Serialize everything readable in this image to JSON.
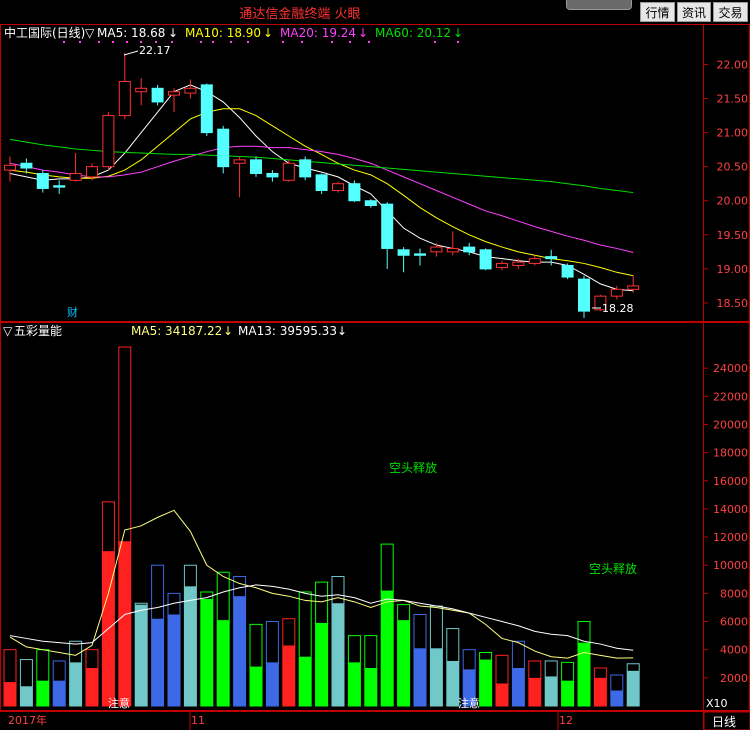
{
  "app": {
    "title": "通达信金融终端  火眼"
  },
  "toolbar": {
    "market": "行情",
    "info": "资讯",
    "trade": "交易"
  },
  "price_panel": {
    "name": "中工国际(日线)",
    "indicators": [
      {
        "label": "MA5: 18.68",
        "color": "#ffffff"
      },
      {
        "label": "MA10: 18.90",
        "color": "#ffff00"
      },
      {
        "label": "MA20: 19.24",
        "color": "#ff40ff"
      },
      {
        "label": "MA60: 20.12",
        "color": "#00e000"
      }
    ],
    "high_label": "22.17",
    "low_label": "18.28",
    "cai_badge": "财",
    "y_ticks": [
      "22.00",
      "21.50",
      "21.00",
      "20.50",
      "20.00",
      "19.50",
      "19.00",
      "18.50"
    ]
  },
  "volume_panel": {
    "name": "五彩量能",
    "indicators": [
      {
        "label": "MA5: 34187.22",
        "color": "#ffff80"
      },
      {
        "label": "MA13: 39595.33",
        "color": "#ffffff"
      }
    ],
    "annotations": [
      "空头释放",
      "空头释放"
    ],
    "notes": [
      "注意",
      "注意"
    ],
    "y_ticks": [
      "24000",
      "22000",
      "20000",
      "18000",
      "16000",
      "14000",
      "12000",
      "10000",
      "8000",
      "6000",
      "4000",
      "2000"
    ],
    "unit": "X10"
  },
  "x_axis": {
    "labels": [
      "2017年",
      "11",
      "12"
    ],
    "period": "日线"
  },
  "colors": {
    "up": "#ff3030",
    "down": "#54ffff",
    "grid": "#c00000",
    "volume_red": "#ff2020",
    "volume_cyan": "#70c8c8",
    "volume_blue": "#3d68e6",
    "volume_green": "#00ff00"
  },
  "chart_data": {
    "type": "candlestick",
    "candles": [
      {
        "o": 20.45,
        "c": 20.52,
        "h": 20.65,
        "l": 20.28
      },
      {
        "o": 20.55,
        "c": 20.48,
        "h": 20.62,
        "l": 20.4
      },
      {
        "o": 20.4,
        "c": 20.18,
        "h": 20.45,
        "l": 20.12
      },
      {
        "o": 20.22,
        "c": 20.2,
        "h": 20.3,
        "l": 20.1
      },
      {
        "o": 20.3,
        "c": 20.4,
        "h": 20.7,
        "l": 20.28
      },
      {
        "o": 20.35,
        "c": 20.5,
        "h": 20.55,
        "l": 20.3
      },
      {
        "o": 20.5,
        "c": 21.25,
        "h": 21.3,
        "l": 20.45
      },
      {
        "o": 21.25,
        "c": 21.75,
        "h": 22.17,
        "l": 21.2
      },
      {
        "o": 21.6,
        "c": 21.65,
        "h": 21.8,
        "l": 21.4
      },
      {
        "o": 21.65,
        "c": 21.45,
        "h": 21.7,
        "l": 21.4
      },
      {
        "o": 21.55,
        "c": 21.6,
        "h": 21.65,
        "l": 21.3
      },
      {
        "o": 21.58,
        "c": 21.65,
        "h": 21.78,
        "l": 21.5
      },
      {
        "o": 21.7,
        "c": 21.0,
        "h": 21.72,
        "l": 20.95
      },
      {
        "o": 21.05,
        "c": 20.5,
        "h": 21.1,
        "l": 20.4
      },
      {
        "o": 20.55,
        "c": 20.6,
        "h": 20.65,
        "l": 20.05
      },
      {
        "o": 20.6,
        "c": 20.4,
        "h": 20.65,
        "l": 20.35
      },
      {
        "o": 20.4,
        "c": 20.35,
        "h": 20.45,
        "l": 20.28
      },
      {
        "o": 20.3,
        "c": 20.55,
        "h": 20.6,
        "l": 20.28
      },
      {
        "o": 20.6,
        "c": 20.35,
        "h": 20.65,
        "l": 20.3
      },
      {
        "o": 20.38,
        "c": 20.15,
        "h": 20.4,
        "l": 20.1
      },
      {
        "o": 20.15,
        "c": 20.25,
        "h": 20.28,
        "l": 20.12
      },
      {
        "o": 20.25,
        "c": 20.0,
        "h": 20.3,
        "l": 19.98
      },
      {
        "o": 20.0,
        "c": 19.93,
        "h": 20.02,
        "l": 19.9
      },
      {
        "o": 19.95,
        "c": 19.3,
        "h": 19.98,
        "l": 19.0
      },
      {
        "o": 19.28,
        "c": 19.2,
        "h": 19.32,
        "l": 18.95
      },
      {
        "o": 19.22,
        "c": 19.2,
        "h": 19.3,
        "l": 19.05
      },
      {
        "o": 19.25,
        "c": 19.32,
        "h": 19.38,
        "l": 19.18
      },
      {
        "o": 19.25,
        "c": 19.3,
        "h": 19.55,
        "l": 19.2
      },
      {
        "o": 19.32,
        "c": 19.25,
        "h": 19.38,
        "l": 19.2
      },
      {
        "o": 19.28,
        "c": 19.0,
        "h": 19.3,
        "l": 18.98
      },
      {
        "o": 19.02,
        "c": 19.08,
        "h": 19.12,
        "l": 18.98
      },
      {
        "o": 19.05,
        "c": 19.1,
        "h": 19.15,
        "l": 19.0
      },
      {
        "o": 19.08,
        "c": 19.15,
        "h": 19.2,
        "l": 19.05
      },
      {
        "o": 19.18,
        "c": 19.15,
        "h": 19.28,
        "l": 19.05
      },
      {
        "o": 19.05,
        "c": 18.88,
        "h": 19.08,
        "l": 18.85
      },
      {
        "o": 18.85,
        "c": 18.38,
        "h": 18.9,
        "l": 18.28
      },
      {
        "o": 18.4,
        "c": 18.6,
        "h": 18.62,
        "l": 18.38
      },
      {
        "o": 18.6,
        "c": 18.7,
        "h": 18.75,
        "l": 18.55
      },
      {
        "o": 18.7,
        "c": 18.75,
        "h": 18.9,
        "l": 18.65
      }
    ],
    "ma_lines": [
      {
        "name": "MA5",
        "color": "#ffffff",
        "values": [
          20.4,
          20.35,
          20.3,
          20.32,
          20.32,
          20.35,
          20.45,
          20.7,
          21.0,
          21.3,
          21.6,
          21.7,
          21.6,
          21.45,
          21.22,
          20.95,
          20.72,
          20.55,
          20.48,
          20.42,
          20.35,
          20.22,
          20.1,
          19.85,
          19.6,
          19.45,
          19.35,
          19.3,
          19.25,
          19.18,
          19.15,
          19.12,
          19.1,
          19.1,
          19.05,
          18.92,
          18.78,
          18.7,
          18.68
        ]
      },
      {
        "name": "MA10",
        "color": "#ffff00",
        "values": [
          20.45,
          20.42,
          20.38,
          20.35,
          20.33,
          20.33,
          20.36,
          20.45,
          20.6,
          20.8,
          21.0,
          21.2,
          21.3,
          21.35,
          21.35,
          21.25,
          21.1,
          20.95,
          20.8,
          20.68,
          20.55,
          20.45,
          20.38,
          20.25,
          20.08,
          19.9,
          19.75,
          19.62,
          19.5,
          19.4,
          19.32,
          19.25,
          19.2,
          19.15,
          19.12,
          19.08,
          19.02,
          18.95,
          18.9
        ]
      },
      {
        "name": "MA20",
        "color": "#ff40ff",
        "values": [
          20.55,
          20.5,
          20.45,
          20.42,
          20.38,
          20.35,
          20.35,
          20.38,
          20.42,
          20.5,
          20.58,
          20.65,
          20.72,
          20.78,
          20.8,
          20.8,
          20.78,
          20.78,
          20.75,
          20.72,
          20.68,
          20.62,
          20.55,
          20.45,
          20.35,
          20.25,
          20.15,
          20.05,
          19.95,
          19.85,
          19.78,
          19.7,
          19.62,
          19.55,
          19.48,
          19.42,
          19.35,
          19.3,
          19.24
        ]
      },
      {
        "name": "MA60",
        "color": "#00e000",
        "values": [
          20.9,
          20.86,
          20.82,
          20.79,
          20.76,
          20.74,
          20.72,
          20.71,
          20.7,
          20.69,
          20.68,
          20.68,
          20.67,
          20.66,
          20.65,
          20.64,
          20.62,
          20.6,
          20.58,
          20.56,
          20.54,
          20.52,
          20.5,
          20.48,
          20.46,
          20.44,
          20.42,
          20.4,
          20.38,
          20.36,
          20.34,
          20.32,
          20.3,
          20.28,
          20.25,
          20.22,
          20.18,
          20.15,
          20.12
        ]
      }
    ],
    "volume": {
      "values": [
        [
          4000,
          1700
        ],
        [
          3300,
          1400
        ],
        [
          4000,
          1800
        ],
        [
          3200,
          1800
        ],
        [
          4600,
          3100
        ],
        [
          4000,
          2700
        ],
        [
          14500,
          11000
        ],
        [
          25500,
          11700
        ],
        [
          7300,
          7200
        ],
        [
          10000,
          6200
        ],
        [
          8000,
          6500
        ],
        [
          10000,
          8500
        ],
        [
          8100,
          7600
        ],
        [
          9500,
          6100
        ],
        [
          9200,
          7800
        ],
        [
          5800,
          2800
        ],
        [
          6000,
          3100
        ],
        [
          6200,
          4300
        ],
        [
          8100,
          3500
        ],
        [
          8800,
          5900
        ],
        [
          9200,
          7300
        ],
        [
          5000,
          3100
        ],
        [
          5000,
          2700
        ],
        [
          11500,
          8200
        ],
        [
          7200,
          6100
        ],
        [
          6500,
          4100
        ],
        [
          7100,
          4100
        ],
        [
          5500,
          3200
        ],
        [
          4000,
          2600
        ],
        [
          3800,
          3300
        ],
        [
          3600,
          1600
        ],
        [
          4600,
          2700
        ],
        [
          3200,
          2000
        ],
        [
          3200,
          2100
        ],
        [
          3100,
          1800
        ],
        [
          6000,
          4500
        ],
        [
          2700,
          2000
        ],
        [
          2200,
          1100
        ],
        [
          3000,
          2500
        ]
      ],
      "color_types": [
        "red",
        "cyan",
        "green",
        "blue",
        "cyan",
        "red",
        "red",
        "red",
        "cyan",
        "blue",
        "blue",
        "cyan",
        "green",
        "green",
        "blue",
        "green",
        "blue",
        "red",
        "green",
        "green",
        "cyan",
        "green",
        "green",
        "green",
        "green",
        "blue",
        "cyan",
        "cyan",
        "blue",
        "green",
        "red",
        "blue",
        "red",
        "cyan",
        "green",
        "green",
        "red",
        "blue",
        "cyan"
      ],
      "ma5": [
        4900,
        4200,
        4000,
        3800,
        3600,
        4300,
        8000,
        12500,
        12800,
        13400,
        13900,
        12400,
        10000,
        9200,
        8700,
        8400,
        8000,
        7800,
        7500,
        7400,
        7700,
        7400,
        7000,
        7400,
        7500,
        7100,
        7000,
        6800,
        6600,
        5800,
        4800,
        4500,
        3900,
        3500,
        3400,
        3800,
        3600,
        3400,
        3420
      ],
      "ma13": [
        5000,
        4800,
        4600,
        4500,
        4400,
        4500,
        5500,
        6500,
        6800,
        7000,
        7300,
        7500,
        7700,
        8100,
        8400,
        8600,
        8500,
        8300,
        8000,
        7800,
        7900,
        7700,
        7300,
        7600,
        7500,
        7300,
        7100,
        6900,
        6600,
        6300,
        6000,
        5700,
        5300,
        5100,
        5000,
        4600,
        4400,
        4100,
        3960
      ]
    },
    "price_range": [
      18.28,
      22.17
    ],
    "volume_range": [
      0,
      26000
    ]
  }
}
